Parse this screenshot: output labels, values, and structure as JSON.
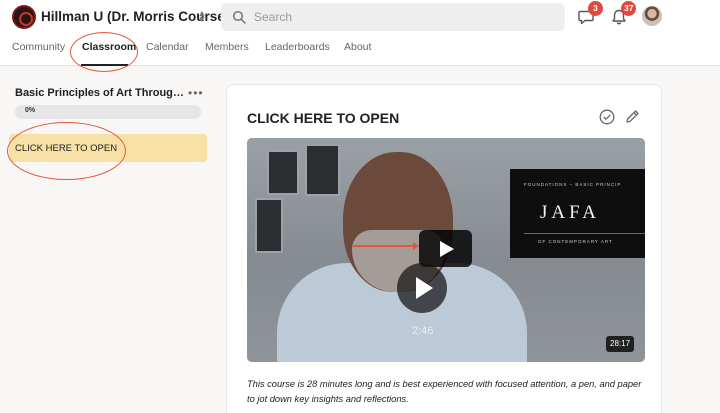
{
  "header": {
    "group_name": "Hillman U (Dr. Morris Course)",
    "search_placeholder": "Search",
    "chat_badge": "3",
    "notification_badge": "37",
    "icons": [
      "logo",
      "switch-icon",
      "search-icon",
      "chat-icon",
      "bell-icon",
      "avatar"
    ]
  },
  "nav": {
    "tabs": [
      {
        "label": "Community",
        "active": false
      },
      {
        "label": "Classroom",
        "active": true
      },
      {
        "label": "Calendar",
        "active": false
      },
      {
        "label": "Members",
        "active": false
      },
      {
        "label": "Leaderboards",
        "active": false
      },
      {
        "label": "About",
        "active": false
      }
    ]
  },
  "sidebar": {
    "course_title": "Basic Principles of Art Through ...",
    "progress_label": "0%",
    "progress": 0,
    "lessons": [
      {
        "label": "CLICK HERE TO OPEN",
        "selected": true
      }
    ]
  },
  "lesson": {
    "title": "CLICK HERE TO OPEN",
    "video": {
      "slide_subtitle": "FOUNDATIONS – BASIC PRINCIP",
      "slide_title": "JAFA",
      "slide_footer": "OF CONTEMPORARY ART",
      "overlay_time": "2:46",
      "duration": "28:17"
    },
    "description": "This course is 28 minutes long and is best experienced with focused attention, a pen, and paper to jot down key insights and reflections."
  },
  "colors": {
    "accent_badge": "#e0493c",
    "annotation_ring": "#e2573d",
    "selected_lesson_bg": "#f7e1a6"
  }
}
